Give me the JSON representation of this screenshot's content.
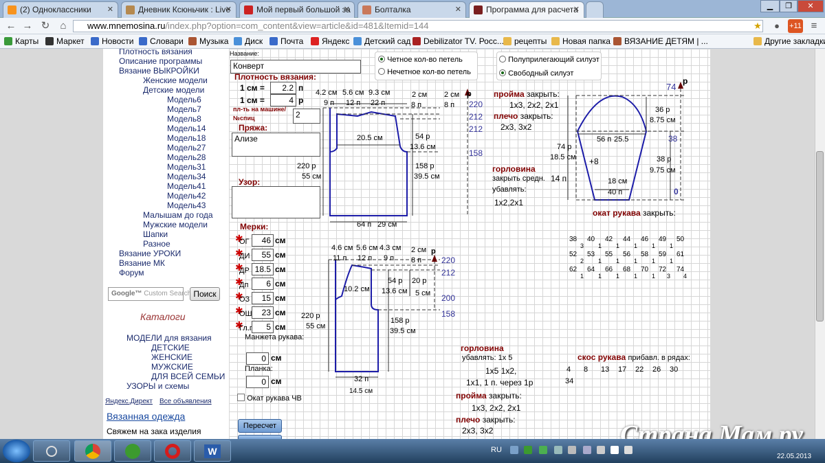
{
  "tabs": [
    {
      "title": "(2) Одноклассники",
      "color": "#f7931e"
    },
    {
      "title": "Дневник Ксюньчик : Live",
      "color": "#b5894f"
    },
    {
      "title": "Мой первый большой за",
      "color": "#cc2222"
    },
    {
      "title": "Болталка",
      "color": "#c9785a"
    },
    {
      "title": "Программа для расчета",
      "color": "#7a1f1f"
    }
  ],
  "url": {
    "host": "www.mnemosina.ru",
    "path": "/index.php?option=com_content&view=article&id=481&Itemid=144"
  },
  "bookmarks": [
    {
      "label": "Карты",
      "color": "#3a9a3a"
    },
    {
      "label": "Маркет",
      "color": "#333333"
    },
    {
      "label": "Новости",
      "color": "#3a6ac9"
    },
    {
      "label": "Словари",
      "color": "#3a6ac9"
    },
    {
      "label": "Музыка",
      "color": "#aa5533"
    },
    {
      "label": "Диск",
      "color": "#4a90d9"
    },
    {
      "label": "Почта",
      "color": "#3a6ac9"
    },
    {
      "label": "Яндекс",
      "color": "#dd2222"
    },
    {
      "label": "Детский сад",
      "color": "#4a90d9"
    },
    {
      "label": "Debilizator TV. Росс...",
      "color": "#aa2222"
    },
    {
      "label": "рецепты",
      "color": "#e8b84a"
    },
    {
      "label": "Новая папка",
      "color": "#e8b84a"
    },
    {
      "label": "ВЯЗАНИЕ ДЕТЯМ | ...",
      "color": "#aa5533"
    }
  ],
  "other_bookmarks": "Другие закладки",
  "sidebar": {
    "items": [
      {
        "label": "Плотность вязания",
        "indent": 0
      },
      {
        "label": "Описание программы",
        "indent": 0
      },
      {
        "label": "Вязание ВЫКРОЙКИ",
        "indent": 0
      },
      {
        "label": "Женские модели",
        "indent": 1
      },
      {
        "label": "Детские модели",
        "indent": 1
      },
      {
        "label": "Модель6",
        "indent": 2
      },
      {
        "label": "Модель7",
        "indent": 2
      },
      {
        "label": "Модель8",
        "indent": 2
      },
      {
        "label": "Модель14",
        "indent": 2
      },
      {
        "label": "Модель18",
        "indent": 2
      },
      {
        "label": "Модель27",
        "indent": 2
      },
      {
        "label": "Модель28",
        "indent": 2
      },
      {
        "label": "Модель31",
        "indent": 2
      },
      {
        "label": "Модель34",
        "indent": 2
      },
      {
        "label": "Модель41",
        "indent": 2
      },
      {
        "label": "Модель42",
        "indent": 2
      },
      {
        "label": "Модель43",
        "indent": 2
      },
      {
        "label": "Малышам до года",
        "indent": 1
      },
      {
        "label": "Мужские модели",
        "indent": 1
      },
      {
        "label": "Шапки",
        "indent": 1
      },
      {
        "label": "Разное",
        "indent": 1
      },
      {
        "label": "Вязание УРОКИ",
        "indent": 0
      },
      {
        "label": "Вязание МК",
        "indent": 0
      },
      {
        "label": "Форум",
        "indent": 0
      }
    ],
    "search_placeholder": "Custom Search",
    "search_button": "Поиск",
    "catalogs_title": "Каталоги",
    "catalog_items": [
      {
        "label": "МОДЕЛИ для вязания",
        "indent": 0
      },
      {
        "label": "ДЕТСКИЕ",
        "indent": 1
      },
      {
        "label": "ЖЕНСКИЕ",
        "indent": 1
      },
      {
        "label": "МУЖСКИЕ",
        "indent": 1
      },
      {
        "label": "ДЛЯ ВСЕЙ СЕМЬИ",
        "indent": 1
      },
      {
        "label": "УЗОРЫ и схемы",
        "indent": 0
      }
    ],
    "direct": "Яндекс.Директ",
    "all_ads": "Все объявления",
    "ad_title": "Вязанная одежда",
    "ad_text": "Свяжем на зака изделия"
  },
  "form": {
    "name_label": "Название:",
    "name_value": "Конверт",
    "density_label": "Плотность вязания:",
    "one_cm": "1 см =",
    "stitches_value": "2.2",
    "stitches_unit": "п",
    "rows_value": "4",
    "rows_unit": "р",
    "machine_label": "пл-ть на машине/",
    "needle_label": "№спиц",
    "needle_value": "2",
    "yarn_label": "Пряжа:",
    "yarn_value": "Ализе",
    "pattern_label": "Узор:",
    "pattern_value": "",
    "measures_label": "Мерки:",
    "measures": [
      {
        "name": "ОГ",
        "value": "46",
        "unit": "см"
      },
      {
        "name": "ДИ",
        "value": "55",
        "unit": "см"
      },
      {
        "name": "ДР",
        "value": "18.5",
        "unit": "см"
      },
      {
        "name": "Дп",
        "value": "6",
        "unit": "см"
      },
      {
        "name": "ОЗ",
        "value": "15",
        "unit": "см"
      },
      {
        "name": "ОШ",
        "value": "23",
        "unit": "см"
      },
      {
        "name": "Гл.г.",
        "value": "5",
        "unit": "см"
      }
    ],
    "cuff_label": "Манжета рукава:",
    "cuff_value": "0",
    "cuff_unit": "см",
    "placket_label": "Планка:",
    "placket_value": "0",
    "placket_unit": "см",
    "sleeve_cap_label": "Окат рукава ЧВ",
    "recalc_button": "Пересчет",
    "even_stitches": "Четное кол-во петель",
    "odd_stitches": "Нечетное кол-во петель",
    "semi_fit": "Полуприлегающий силуэт",
    "loose_fit": "Свободный силуэт"
  },
  "diagram_back": {
    "labels": [
      "4.2 см",
      "5.6 см",
      "9.3 см",
      "9 п",
      "12 п",
      "22 п",
      "2 см",
      "2 см",
      "р",
      "8 п",
      "8 п",
      "220",
      "212",
      "212",
      "20.5 см",
      "54 р",
      "13.6 см",
      "158",
      "220 р",
      "55 см",
      "158 р",
      "39.5 см",
      "64 п",
      "29 см"
    ]
  },
  "diagram_front": {
    "labels": [
      "4.6 см",
      "5.6 см",
      "4.3 см",
      "2 см",
      "11 п",
      "12 п",
      "9 п",
      "8 п",
      "р",
      "220",
      "212",
      "10.2 см",
      "54 р",
      "13.6 см",
      "20 р",
      "5 см",
      "200",
      "158",
      "220 р",
      "55 см",
      "158 р",
      "39.5 см",
      "32 п",
      "14.5 см"
    ]
  },
  "armhole": {
    "title": "пройма",
    "close": "закрыть:",
    "values": "1х3, 2х2, 2х1",
    "shoulder_title": "плечо",
    "shoulder_values": "2х3, 3х2",
    "neck_title": "горловина",
    "neck_close": "закрыть средн.",
    "neck_close_value": "14 п",
    "neck_decrease": "убавлять:",
    "neck_values": "1х2,2х1"
  },
  "sleeve": {
    "top_value": "74",
    "r": "р",
    "cap_rows": "36 р",
    "cap_cm": "8.75 см",
    "val_38": "38",
    "width": "56 п",
    "width_cm": "25.5",
    "plus8": "+8",
    "height_r": "74 р",
    "height_cm": "18.5 см",
    "lower_r": "38 р",
    "lower_cm": "9.75 см",
    "cuff_cm": "18 см",
    "cuff_p": "40 п",
    "zero": "0",
    "cap_title": "окат рукава",
    "cap_close": "закрыть:",
    "table_rows": [
      [
        "38",
        "40",
        "42",
        "44",
        "46",
        "49",
        "50"
      ],
      [
        "52",
        "53",
        "55",
        "56",
        "58",
        "59",
        "61"
      ],
      [
        "62",
        "64",
        "66",
        "68",
        "70",
        "72",
        "74"
      ]
    ],
    "table_sub": [
      "3",
      "1",
      "1",
      "1",
      "1",
      "1",
      "2",
      "1",
      "1",
      "1",
      "1",
      "1",
      "1",
      "1",
      "1",
      "1",
      "1",
      "3",
      "4"
    ]
  },
  "front_texts": {
    "neck_title": "горловина",
    "neck_decrease": "убавлять: 1х 5",
    "neck_line1": "1х5 1х2,",
    "neck_line2": "1х1, 1 п. через 1р",
    "armhole_title": "пройма",
    "armhole_close": "закрыть:",
    "armhole_values": "1х3, 2х2, 2х1",
    "shoulder_title": "плечо",
    "shoulder_close": "закрыть:",
    "shoulder_values": "2х3, 3х2",
    "sleeve_slope_title": "скос рукава",
    "sleeve_slope_text": "прибавл. в рядах:",
    "slope_values": [
      "4",
      "8",
      "13",
      "17",
      "22",
      "26",
      "30"
    ],
    "slope_extra": "34"
  },
  "taskbar": {
    "lang": "RU",
    "time": "",
    "date": "22.05.2013"
  },
  "watermark": "Страна Мам.ру"
}
